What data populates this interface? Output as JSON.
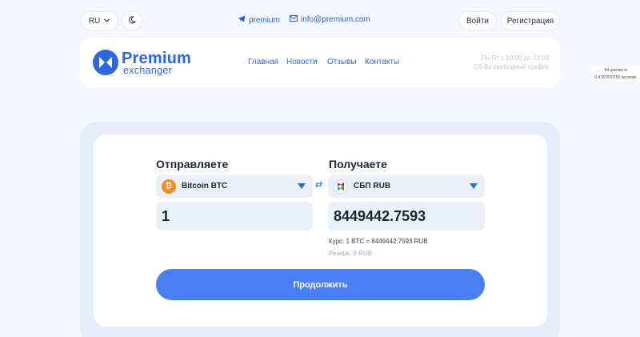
{
  "topbar": {
    "lang": "RU",
    "telegram": "premium",
    "email": "info@premium.com",
    "login": "Войти",
    "register": "Регистрация"
  },
  "header": {
    "logo_title": "Premium",
    "logo_sub": "exchanger",
    "nav": [
      "Главная",
      "Новости",
      "Отзывы",
      "Контакты"
    ],
    "hours_line1": "Пн-Пт с 10:00 до 23:00",
    "hours_line2": "Сб-Вс свободный график"
  },
  "debug": {
    "line1": "54 queries in",
    "line2": "0.4787070751 seconds."
  },
  "exchange": {
    "send_title": "Отправляете",
    "receive_title": "Получаете",
    "send_currency": "Bitcoin BTC",
    "receive_currency": "СБП RUB",
    "send_amount": "1",
    "receive_amount": "8449442.7593",
    "rate": "Курс: 1 BTC = 8449442.7593 RUB",
    "reserve": "Резерв: 0 RUB",
    "continue_label": "Продолжить"
  },
  "colors": {
    "accent": "#2e67dc",
    "button": "#4a7ef3",
    "bitcoin": "#f2901d"
  },
  "icons": [
    "chevron-down-icon",
    "moon-icon",
    "telegram-icon",
    "mail-icon",
    "bitcoin-icon",
    "sbp-icon",
    "swap-icon",
    "caret-down-icon"
  ]
}
